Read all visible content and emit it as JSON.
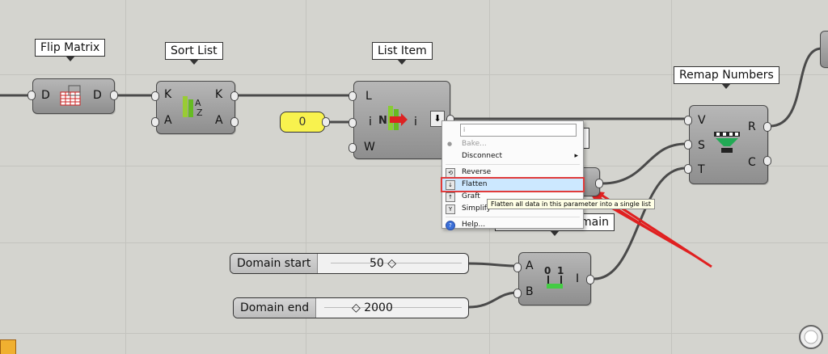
{
  "components": {
    "flip_matrix": {
      "title": "Flip Matrix",
      "in": "D",
      "out": "D"
    },
    "sort_list": {
      "title": "Sort List",
      "in1": "K",
      "in2": "A",
      "out1": "K",
      "out2": "A"
    },
    "list_item": {
      "title": "List Item",
      "in1": "L",
      "in2": "i",
      "in3": "W",
      "out": "i"
    },
    "remap": {
      "title": "Remap Numbers",
      "in1": "V",
      "in2": "S",
      "in3": "T",
      "out1": "R",
      "out2": "C"
    },
    "construct_domain": {
      "title_fragment": "main",
      "in1": "A",
      "in2": "B",
      "out": "I"
    }
  },
  "panel_index": {
    "value": "0"
  },
  "sliders": {
    "domain_start": {
      "name": "Domain start",
      "value": "50"
    },
    "domain_end": {
      "name": "Domain end",
      "value": "2000"
    }
  },
  "context_menu": {
    "name_field": "i",
    "items": [
      "Bake...",
      "Disconnect",
      "Reverse",
      "Flatten",
      "Graft",
      "Simplify",
      "Help..."
    ],
    "highlighted": "Flatten",
    "tooltip": "Flatten all data in this parameter into a single list"
  },
  "colors": {
    "canvas": "#d4d4cf",
    "highlight": "#cce8ff",
    "highlight_border": "#e03b3b",
    "arrow": "#e02020"
  }
}
